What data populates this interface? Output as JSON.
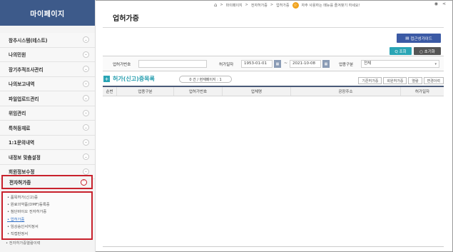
{
  "sidebar": {
    "title": "마이페이지",
    "items": [
      {
        "label": "창추시스템(테스트)"
      },
      {
        "label": "나의민원"
      },
      {
        "label": "장기추적조사관리"
      },
      {
        "label": "나의보고내역"
      },
      {
        "label": "파일업로드관리"
      },
      {
        "label": "위임관리"
      },
      {
        "label": "특허등재료"
      },
      {
        "label": "1:1문의내역"
      },
      {
        "label": "내정보 맞춤설정"
      },
      {
        "label": "회원정보수정"
      }
    ],
    "active": {
      "label": "전자허가증"
    },
    "sub_items": [
      {
        "label": "• 품목허가(신고)증"
      },
      {
        "label": "• 원료의약품(DMF)등록증"
      },
      {
        "label": "• 첨단바이오 전자허가증"
      },
      {
        "label": "• 업허가증"
      },
      {
        "label": "• 임상승인서지정서"
      },
      {
        "label": "• 직접판정서"
      }
    ],
    "after_item": "• 전자허가증열람이력"
  },
  "topbar": {
    "crumb1": "마이페이지",
    "sep": ">",
    "crumb2": "전자허가증",
    "crumb3": "업허가증",
    "favorite_text": "자주 사용하는 메뉴를 즐겨찾기 하세요!"
  },
  "page": {
    "title": "업허가증"
  },
  "buttons": {
    "guide": "접근성가이드",
    "search": "Q 조회",
    "reset": "○ 초기화"
  },
  "search_form": {
    "permit_no_label": "업허가번호",
    "permit_no_value": "",
    "date_label": "허가일자",
    "date_from": "1953-01-01",
    "date_to": "2021-10-08",
    "date_sep": "~",
    "type_label": "업종구분",
    "type_value": "전체"
  },
  "list": {
    "title": "허가(신고)증목록",
    "count": "0 건 / 현재페이지 : 1",
    "action_buttons": [
      "기존허가증",
      "회원허가증",
      "열람",
      "변경이력"
    ],
    "columns": [
      "순번",
      "업종구분",
      "업허가번호",
      "업체명",
      "공장주소",
      "허가일자"
    ]
  }
}
